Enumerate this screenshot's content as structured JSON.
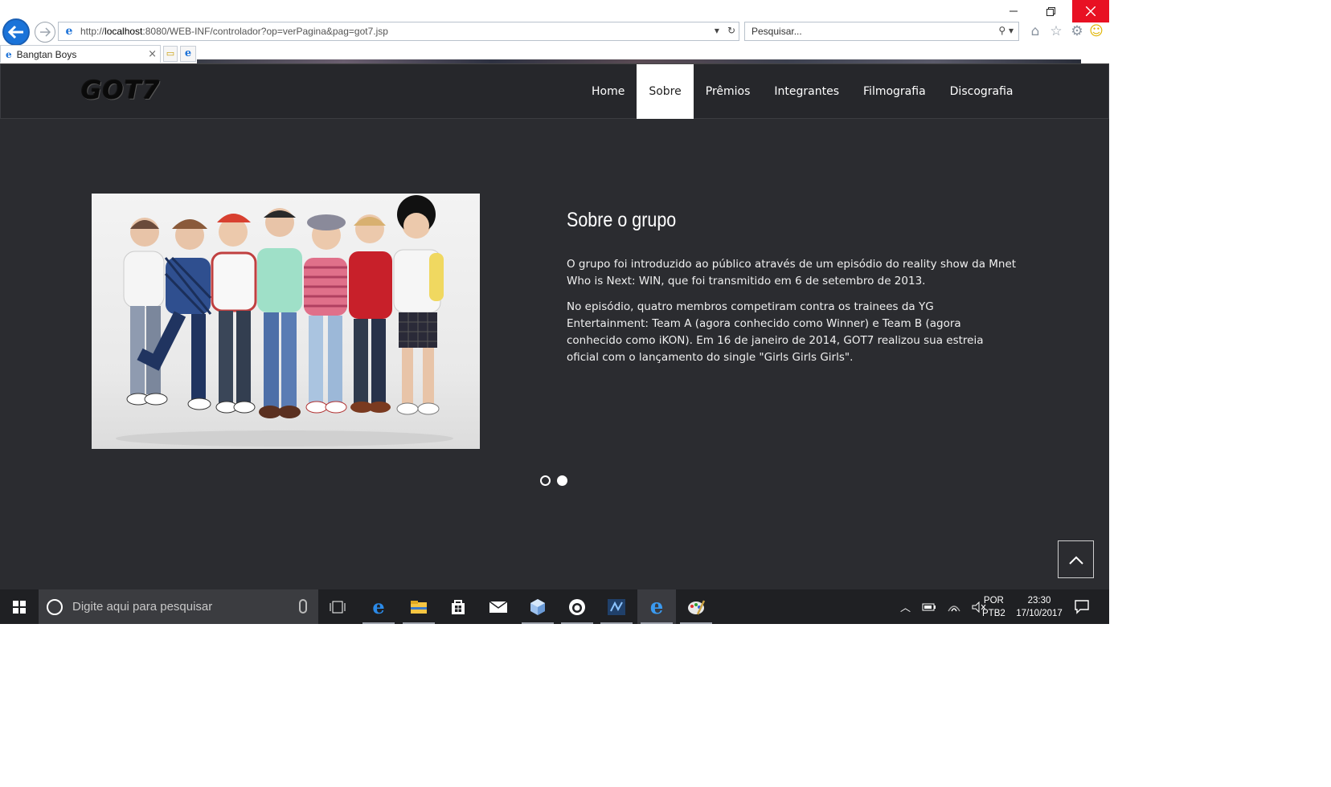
{
  "window": {
    "minimize_icon": "minimize-icon",
    "restore_icon": "restore-icon",
    "close_icon": "close-icon"
  },
  "browser": {
    "address_scheme": "http://",
    "address_host": "localhost",
    "address_rest": ":8080/WEB-INF/controlador?op=verPagina&pag=got7.jsp",
    "search_placeholder": "Pesquisar...",
    "tab_title": "Bangtan Boys"
  },
  "site": {
    "logo": "GOT7",
    "menu": [
      {
        "label": "Home",
        "active": false
      },
      {
        "label": "Sobre",
        "active": true
      },
      {
        "label": "Prêmios",
        "active": false
      },
      {
        "label": "Integrantes",
        "active": false
      },
      {
        "label": "Filmografia",
        "active": false
      },
      {
        "label": "Discografia",
        "active": false
      }
    ],
    "about": {
      "title": "Sobre o grupo",
      "p1": "O grupo foi introduzido ao público através de um episódio do reality show da Mnet Who is Next: WIN, que foi transmitido em 6 de setembro de 2013.",
      "p2": "No episódio, quatro membros competiram contra os trainees da YG Entertainment: Team A (agora conhecido como Winner) e Team B (agora conhecido como iKON). Em 16 de janeiro de 2014, GOT7 realizou sua estreia oficial com o lançamento do single \"Girls Girls Girls\"."
    },
    "carousel": {
      "slides": 2,
      "current": 2
    }
  },
  "taskbar": {
    "search_placeholder": "Digite aqui para pesquisar",
    "lang_line1": "POR",
    "lang_line2": "PTB2",
    "time": "23:30",
    "date": "17/10/2017"
  },
  "colors": {
    "site_bg": "#2b2c30",
    "nav_bg": "#26272b",
    "close_red": "#e81123",
    "ie_blue": "#1e73d8",
    "taskbar_bg": "#1f2023"
  }
}
